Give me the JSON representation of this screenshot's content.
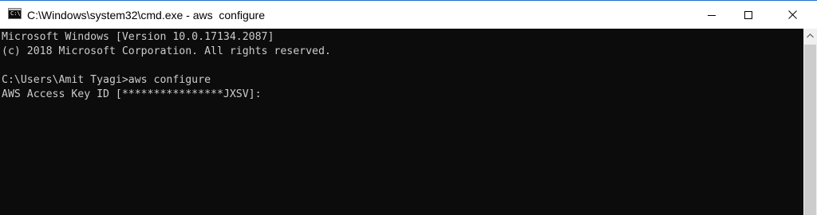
{
  "window": {
    "title": "C:\\Windows\\system32\\cmd.exe - aws  configure",
    "icon": "cmd-prompt-icon",
    "icon_glyph": "C:\\."
  },
  "controls": {
    "minimize": "minimize-icon",
    "maximize": "maximize-icon",
    "close": "close-icon"
  },
  "console": {
    "lines": [
      "Microsoft Windows [Version 10.0.17134.2087]",
      "(c) 2018 Microsoft Corporation. All rights reserved.",
      "",
      "C:\\Users\\Amit Tyagi>aws configure",
      "AWS Access Key ID [****************JXSV]:"
    ]
  },
  "colors": {
    "console_bg": "#0c0c0c",
    "console_text": "#cccccc",
    "titlebar_bg": "#ffffff",
    "scrollbar_bg": "#f0f0f0"
  }
}
